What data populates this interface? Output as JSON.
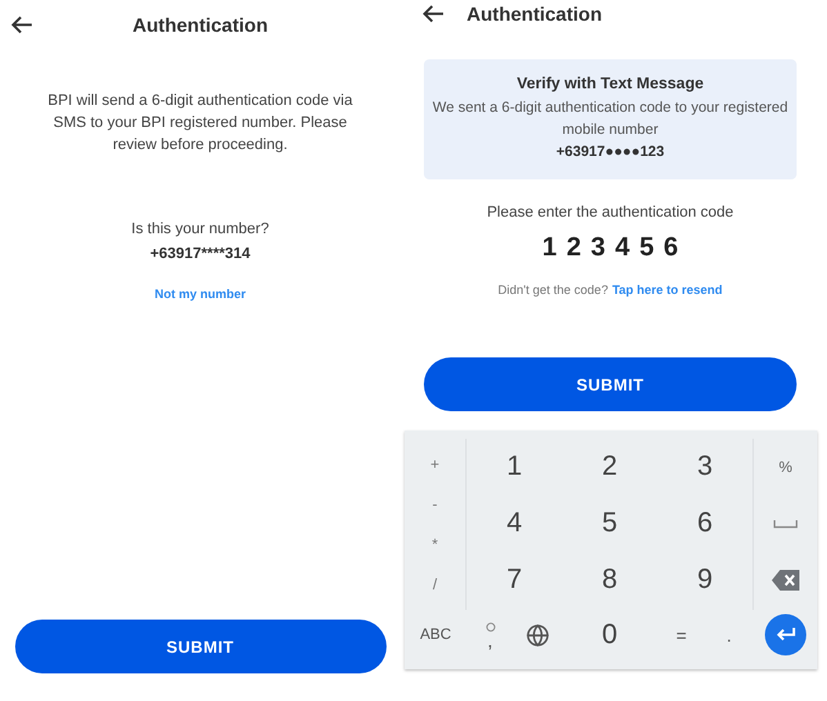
{
  "left_screen": {
    "title": "Authentication",
    "message": "BPI will send a 6-digit authentication code via SMS to your BPI registered number. Please review before proceeding.",
    "question": "Is this your number?",
    "phone_number": "+63917****314",
    "link": "Not my number",
    "submit": "SUBMIT"
  },
  "right_screen": {
    "title": "Authentication",
    "card": {
      "heading": "Verify with Text Message",
      "message": "We sent a 6-digit authentication code to your registered mobile number",
      "phone_number": "+63917●●●●123"
    },
    "prompt": "Please enter the authentication code",
    "code": [
      "1",
      "2",
      "3",
      "4",
      "5",
      "6"
    ],
    "resend_prompt": "Didn't get the code?",
    "resend_link": "Tap here to resend",
    "submit": "SUBMIT"
  },
  "keyboard": {
    "side_keys": [
      "+",
      "-",
      "*",
      "/"
    ],
    "digit_keys": [
      "1",
      "2",
      "3",
      "4",
      "5",
      "6",
      "7",
      "8",
      "9"
    ],
    "action_keys": [
      {
        "kind": "text",
        "label": "%"
      },
      {
        "kind": "space"
      },
      {
        "kind": "backspace"
      }
    ],
    "bottom_keys": [
      {
        "kind": "text",
        "label": "ABC"
      },
      {
        "kind": "comma",
        "label": ","
      },
      {
        "kind": "globe"
      },
      {
        "kind": "digit",
        "label": "0"
      },
      {
        "kind": "text",
        "label": "="
      },
      {
        "kind": "text",
        "label": "."
      },
      {
        "kind": "enter"
      }
    ]
  }
}
